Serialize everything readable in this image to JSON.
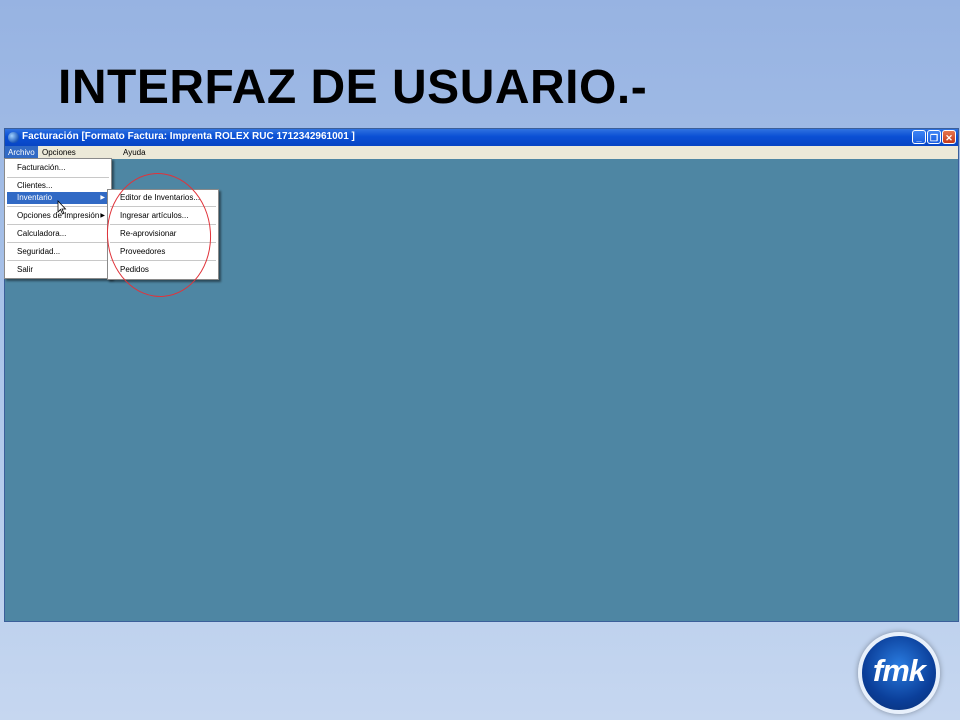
{
  "slide": {
    "title": "INTERFAZ DE USUARIO.-"
  },
  "window": {
    "title": "Facturación [Formato Factura: Imprenta ROLEX RUC 1712342961001 ]",
    "controls": {
      "minimize": "_",
      "restore": "❐",
      "close": "✕"
    }
  },
  "menubar": {
    "items": [
      {
        "label": "Archivo"
      },
      {
        "label": "Opciones"
      },
      {
        "label": "Ayuda"
      }
    ]
  },
  "archivo_menu": {
    "items": [
      {
        "label": "Facturación..."
      },
      {
        "label": "Clientes..."
      },
      {
        "label": "Inventario"
      },
      {
        "label": "Opciones de Impresión"
      },
      {
        "label": "Calculadora..."
      },
      {
        "label": "Seguridad..."
      },
      {
        "label": "Salir"
      }
    ]
  },
  "inventario_submenu": {
    "items": [
      {
        "label": "Editor de Inventarios..."
      },
      {
        "label": "Ingresar artículos..."
      },
      {
        "label": "Re-aprovisionar"
      },
      {
        "label": "Proveedores"
      },
      {
        "label": "Pedidos"
      }
    ]
  },
  "logo": {
    "text": "fmk"
  },
  "colors": {
    "accent": "#316ac5",
    "desktop": "#4e86a3",
    "highlight_ellipse": "#e0333a"
  }
}
